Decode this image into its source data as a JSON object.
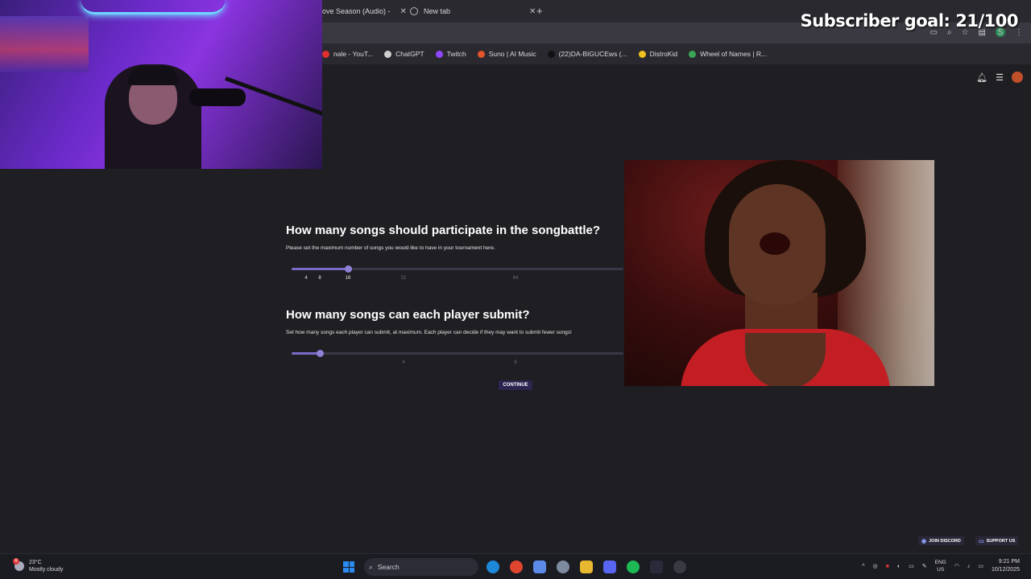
{
  "browser": {
    "tabs": [
      {
        "label": "ove Season (Audio) -"
      },
      {
        "label": "New tab"
      }
    ],
    "bookmarks": [
      {
        "label": "nale - YouT...",
        "color": "#e03030"
      },
      {
        "label": "ChatGPT",
        "color": "#cfcfcf"
      },
      {
        "label": "Twitch",
        "color": "#9146ff"
      },
      {
        "label": "Suno | AI Music",
        "color": "#e0552a"
      },
      {
        "label": "(22)DA-BIGUCEws (...",
        "color": "#111111"
      },
      {
        "label": "DistroKid",
        "color": "#f0c020"
      },
      {
        "label": "Wheel of Names | R...",
        "color": "#3aa655"
      }
    ],
    "profile_initial": "S"
  },
  "overlay": {
    "subscriber_goal": "Subscriber goal: 21/100"
  },
  "main": {
    "q1": {
      "title": "How many songs should participate in the songbattle?",
      "description": "Please set the maximum number of songs you would like to have in your tournament here.",
      "selected_value": 16,
      "ticks": [
        "4",
        "8",
        "16",
        "32",
        "64"
      ]
    },
    "q2": {
      "title": "How many songs can each player submit?",
      "description": "Set how many songs each player can submit, at maximum. Each player can decide if they may want to submit fewer songs!",
      "selected_value": 2,
      "ticks": [
        "4",
        "8"
      ]
    },
    "continue_label": "CONTINUE"
  },
  "footer": {
    "discord_label": "JOIN DISCORD",
    "support_label": "SUPPORT US"
  },
  "taskbar": {
    "weather_temp": "23°C",
    "weather_desc": "Mostly cloudy",
    "weather_badge": "6",
    "search_placeholder": "Search",
    "lang_top": "ENG",
    "lang_bottom": "US",
    "time": "9:21 PM",
    "date": "10/12/2025"
  },
  "colors": {
    "accent": "#7b6bc9",
    "background": "#1f1e23",
    "continue_bg": "#2b2550"
  }
}
